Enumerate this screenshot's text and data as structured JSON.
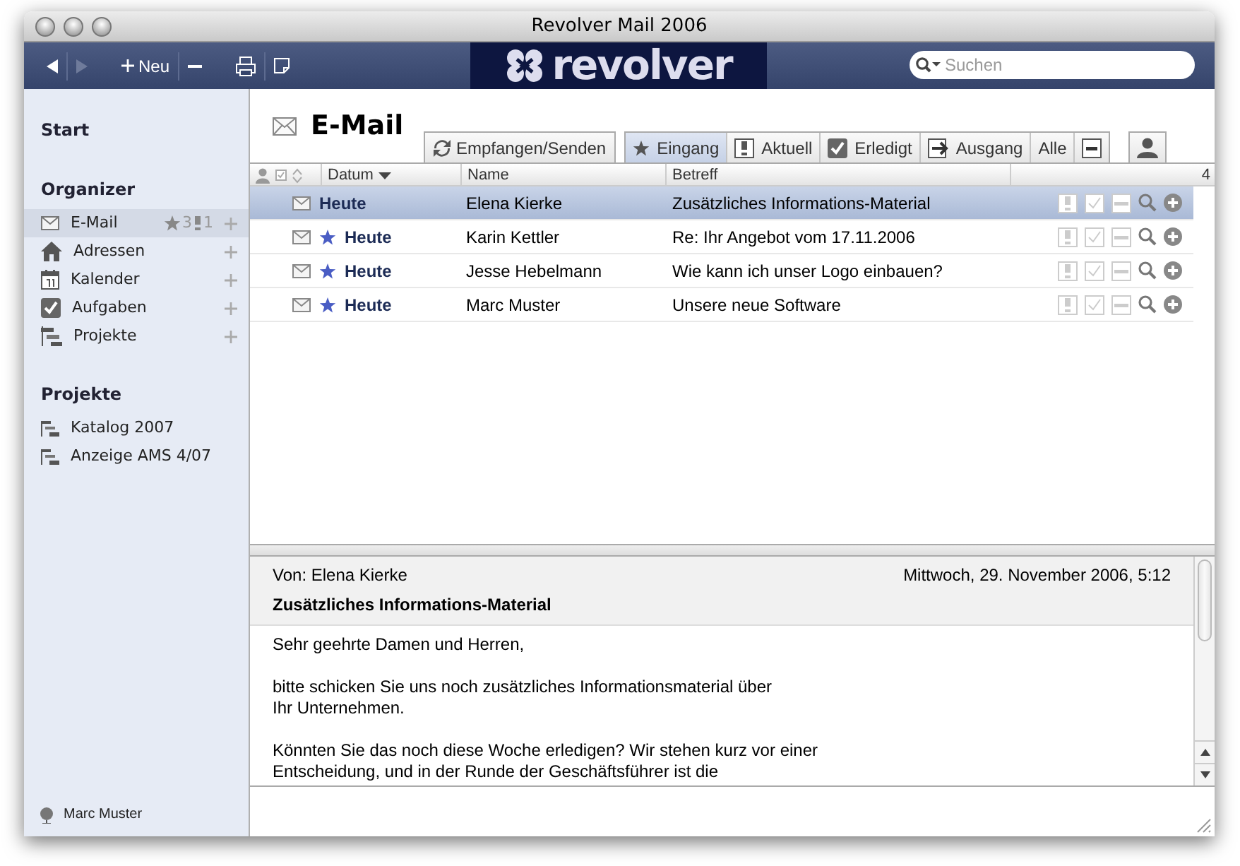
{
  "window": {
    "title": "Revolver Mail 2006"
  },
  "toolbar": {
    "new_label": "Neu",
    "logo": "revolver",
    "search": {
      "placeholder": "Suchen"
    },
    "forward_disabled": true
  },
  "sidebar": {
    "start": "Start",
    "sections": [
      {
        "title": "Organizer",
        "items": [
          {
            "label": "E-Mail",
            "selected": true,
            "starred_count": "3",
            "flagged_count": "1"
          },
          {
            "label": "Adressen",
            "selected": false
          },
          {
            "label": "Kalender",
            "selected": false
          },
          {
            "label": "Aufgaben",
            "selected": false
          },
          {
            "label": "Projekte",
            "selected": false
          }
        ]
      },
      {
        "title": "Projekte",
        "items": [
          {
            "label": "Katalog 2007",
            "selected": false
          },
          {
            "label": "Anzeige AMS 4/07",
            "selected": false
          }
        ]
      }
    ],
    "user": "Marc Muster"
  },
  "main": {
    "title": "E-Mail",
    "send_receive": "Empfangen/Senden",
    "filters": [
      {
        "label": "Eingang",
        "selected": true
      },
      {
        "label": "Aktuell",
        "selected": false
      },
      {
        "label": "Erledigt",
        "selected": false
      },
      {
        "label": "Ausgang",
        "selected": false
      },
      {
        "label": "Alle",
        "selected": false
      }
    ],
    "columns": [
      "Datum",
      "Name",
      "Betreff"
    ],
    "count": "4",
    "rows": [
      {
        "date": "Heute",
        "name": "Elena Kierke",
        "subject": "Zusätzliches Informations-Material",
        "starred": false,
        "selected": true
      },
      {
        "date": "Heute",
        "name": "Karin Kettler",
        "subject": "Re: Ihr Angebot vom 17.11.2006",
        "starred": true,
        "selected": false
      },
      {
        "date": "Heute",
        "name": "Jesse Hebelmann",
        "subject": "Wie kann ich unser Logo einbauen?",
        "starred": true,
        "selected": false
      },
      {
        "date": "Heute",
        "name": "Marc Muster",
        "subject": "Unsere neue Software",
        "starred": true,
        "selected": false
      }
    ]
  },
  "preview": {
    "from": "Von: Elena Kierke",
    "date": "Mittwoch, 29. November 2006, 5:12",
    "subject": "Zusätzliches Informations-Material",
    "paragraphs": [
      [
        "Sehr geehrte Damen und Herren,"
      ],
      [
        "bitte schicken Sie uns noch zusätzliches Informationsmaterial über",
        "Ihr Unternehmen."
      ],
      [
        "Könnten Sie das noch diese Woche erledigen? Wir stehen kurz vor einer",
        "Entscheidung, und in der Runde der Geschäftsführer ist die"
      ]
    ]
  }
}
